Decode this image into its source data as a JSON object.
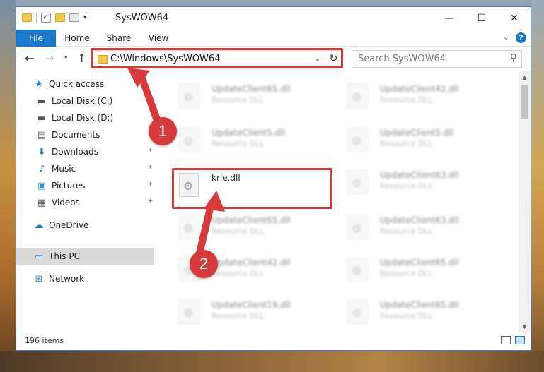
{
  "window": {
    "title": "SysWOW64",
    "controls": {
      "minimize": "—",
      "maximize": "☐",
      "close": "✕"
    }
  },
  "ribbon": {
    "tabs": [
      "File",
      "Home",
      "Share",
      "View"
    ],
    "collapse": "⌄",
    "help": "?"
  },
  "nav": {
    "address": "C:\\Windows\\SysWOW64",
    "search_placeholder": "Search SysWOW64"
  },
  "sidebar": {
    "items": [
      {
        "label": "Quick access",
        "icon": "star-icon"
      },
      {
        "label": "Local Disk (C:)",
        "icon": "drive-icon"
      },
      {
        "label": "Local Disk (D:)",
        "icon": "drive-icon"
      },
      {
        "label": "Documents",
        "icon": "documents-icon"
      },
      {
        "label": "Downloads",
        "icon": "downloads-icon"
      },
      {
        "label": "Music",
        "icon": "music-icon"
      },
      {
        "label": "Pictures",
        "icon": "pictures-icon"
      },
      {
        "label": "Videos",
        "icon": "videos-icon"
      },
      {
        "label": "OneDrive",
        "icon": "cloud-icon"
      },
      {
        "label": "This PC",
        "icon": "computer-icon"
      },
      {
        "label": "Network",
        "icon": "network-icon"
      }
    ]
  },
  "files": {
    "type": "Resource DLL",
    "left": [
      "UpdateClient65.dll",
      "UpdateClient5.dll",
      "krle.dll",
      "UpdateClient65.dll",
      "UpdateClient42.dll",
      "UpdateClient19.dll"
    ],
    "right": [
      "UpdateClient42.dll",
      "UpdateClient5.dll",
      "UpdateClient63.dll",
      "UpdateClient63.dll",
      "UpdateClient65.dll",
      "UpdateClient65.dll"
    ]
  },
  "status": {
    "item_count": "196 items"
  },
  "callouts": {
    "step1": "1",
    "step2": "2"
  },
  "colors": {
    "accent": "#1979ca",
    "highlight": "#d63a3a"
  }
}
